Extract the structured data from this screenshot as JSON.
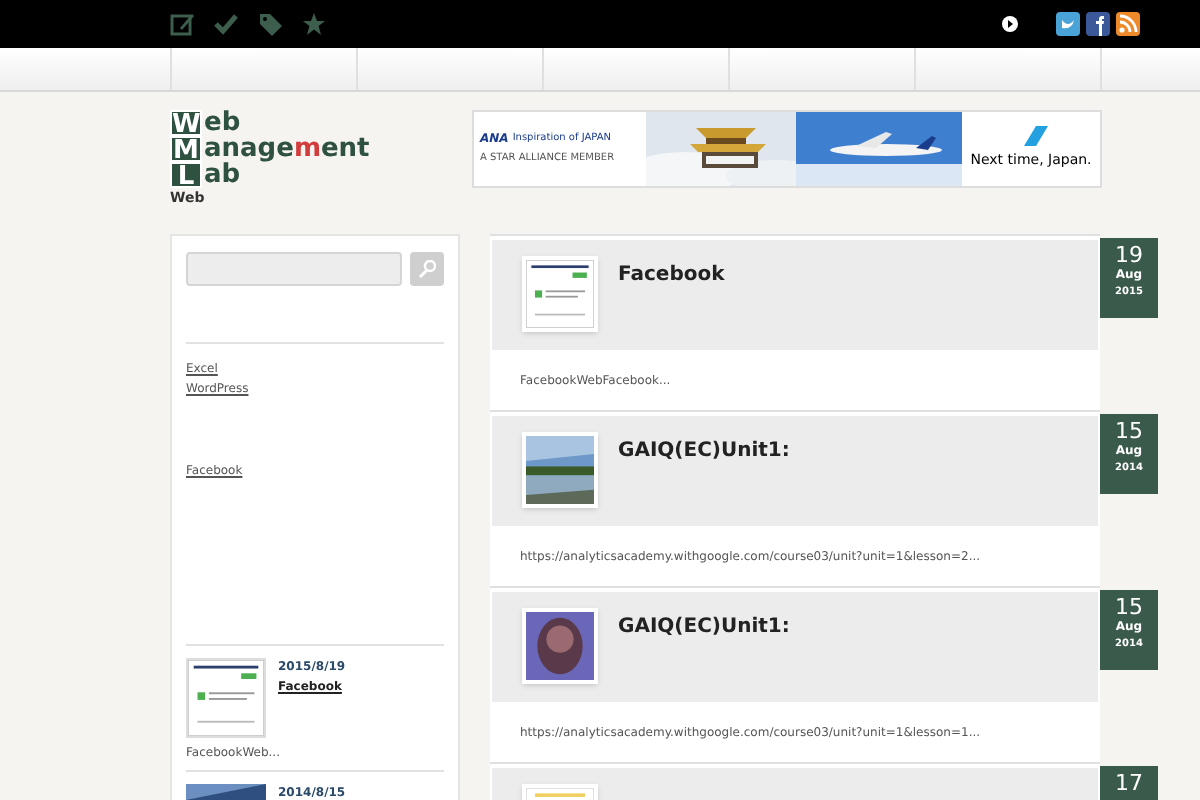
{
  "top_bar": {
    "icons": [
      {
        "kind": "edit"
      },
      {
        "kind": "check"
      },
      {
        "kind": "tag"
      },
      {
        "kind": "star"
      }
    ],
    "social": [
      {
        "kind": "arrow"
      },
      {
        "kind": "twitter"
      },
      {
        "kind": "facebook"
      },
      {
        "kind": "rss"
      }
    ]
  },
  "logo": {
    "lines": [
      {
        "initial": "W",
        "parts": [
          {
            "text": "eb",
            "accent": false
          }
        ]
      },
      {
        "initial": "M",
        "parts": [
          {
            "text": "anage",
            "accent": false
          },
          {
            "text": "m",
            "accent": true
          },
          {
            "text": "ent",
            "accent": false
          }
        ]
      },
      {
        "initial": "L",
        "parts": [
          {
            "text": "ab",
            "accent": false
          }
        ]
      }
    ]
  },
  "ad": {
    "brand": "ANA",
    "tagline": "Inspiration of JAPAN",
    "member": "A STAR ALLIANCE MEMBER",
    "headline": "Next time, Japan."
  },
  "breadcrumb": "Web",
  "sidebar": {
    "link_groups": [
      {
        "links": [
          {
            "label": "Excel"
          },
          {
            "label": "WordPress"
          }
        ]
      },
      {
        "links": [
          {
            "label": "Facebook"
          }
        ]
      }
    ],
    "recent": [
      {
        "kind": "screenshot",
        "date": "2015/8/19",
        "title": "Facebook",
        "excerpt": "FacebookWeb..."
      },
      {
        "kind": "picture",
        "date": "2014/8/15"
      }
    ]
  },
  "posts": [
    {
      "kind": "screenshot",
      "title": "Facebook",
      "excerpt": "FacebookWebFacebook...",
      "day": "19",
      "month": "Aug",
      "year": "2015"
    },
    {
      "kind": "landscape",
      "title": "GAIQ(EC)Unit1:",
      "excerpt": "https://analyticsacademy.withgoogle.com/course03/unit?unit=1&lesson=2...",
      "day": "15",
      "month": "Aug",
      "year": "2014"
    },
    {
      "kind": "purple",
      "title": "GAIQ(EC)Unit1:",
      "excerpt": "https://analyticsacademy.withgoogle.com/course03/unit?unit=1&lesson=1...",
      "day": "15",
      "month": "Aug",
      "year": "2014"
    },
    {
      "kind": "stars",
      "day": "17"
    }
  ]
}
